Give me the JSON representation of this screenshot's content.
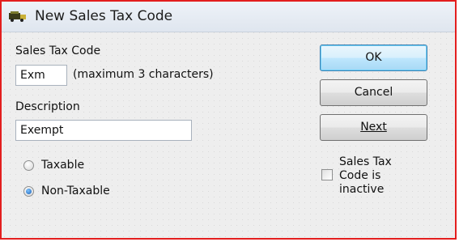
{
  "window": {
    "title": "New Sales Tax Code",
    "icon": "sales-tax-code-icon"
  },
  "form": {
    "code_label": "Sales Tax Code",
    "code_value": "Exm",
    "code_hint": "(maximum 3 characters)",
    "description_label": "Description",
    "description_value": "Exempt",
    "taxable_label": "Taxable",
    "taxable_selected": false,
    "non_taxable_label": "Non-Taxable",
    "non_taxable_selected": true
  },
  "buttons": {
    "ok_label": "OK",
    "cancel_label": "Cancel",
    "next_label": "Next"
  },
  "inactive": {
    "label_line1": "Sales Tax",
    "label_line2": "Code is",
    "label_line3": "inactive",
    "checked": false
  },
  "colors": {
    "frame_border": "#e31e1e",
    "default_button": "#3c7fb1"
  }
}
